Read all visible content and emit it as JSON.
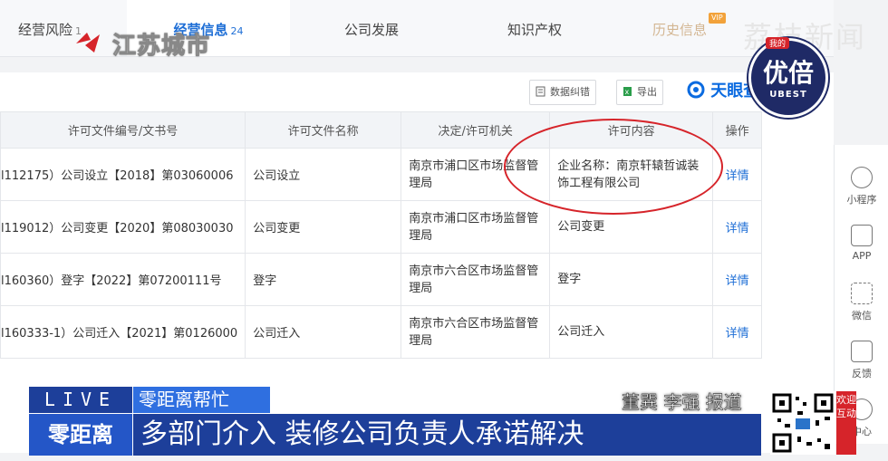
{
  "tabs": [
    {
      "label": "经营风险",
      "count": "1"
    },
    {
      "label": "经营信息",
      "count": "24"
    },
    {
      "label": "公司发展",
      "count": ""
    },
    {
      "label": "知识产权",
      "count": ""
    },
    {
      "label": "历史信息",
      "count": "",
      "badge": "VIP"
    }
  ],
  "overlay": {
    "logo_text": "江苏城市",
    "watermark": "荔枝新闻"
  },
  "toolbar": {
    "correct_label": "数据纠错",
    "export_label": "导出",
    "brand": "天眼查"
  },
  "table": {
    "headers": [
      "许可文件编号/文书号",
      "许可文件名称",
      "决定/许可机关",
      "许可内容",
      "操作"
    ],
    "rows": [
      [
        "l112175）公司设立【2018】第03060006",
        "公司设立",
        "南京市浦口区市场监督管理局",
        "企业名称：南京轩辕哲诚装饰工程有限公司",
        "详情"
      ],
      [
        "l119012）公司变更【2020】第08030030",
        "公司变更",
        "南京市浦口区市场监督管理局",
        "公司变更",
        "详情"
      ],
      [
        "l160360）登字【2022】第07200111号",
        "登字",
        "南京市六合区市场监督管理局",
        "登字",
        "详情"
      ],
      [
        "l160333-1）公司迁入【2021】第0126000",
        "公司迁入",
        "南京市六合区市场监督管理局",
        "公司迁入",
        "详情"
      ]
    ]
  },
  "sidebar": [
    {
      "label": "小程序",
      "icon": "mini-program-icon"
    },
    {
      "label": "APP",
      "icon": "phone-icon"
    },
    {
      "label": "微信",
      "icon": "qrcode-icon"
    },
    {
      "label": "反馈",
      "icon": "feedback-edit-icon"
    },
    {
      "label": "中心",
      "icon": "help-icon"
    }
  ],
  "ubest": {
    "cn": "优倍",
    "en": "UBEST",
    "tag": "我的"
  },
  "news": {
    "live": "LIVE",
    "program": "零距离帮忙",
    "reporters": "董巽 李强 报道",
    "brand": "零距离",
    "headline": "多部门介入 装修公司负责人承诺解决",
    "qr_label": "欢迎互动"
  },
  "colors": {
    "accent": "#1f6fd6",
    "annotation_red": "#d6242a",
    "news_blue": "#1d3f9a"
  }
}
